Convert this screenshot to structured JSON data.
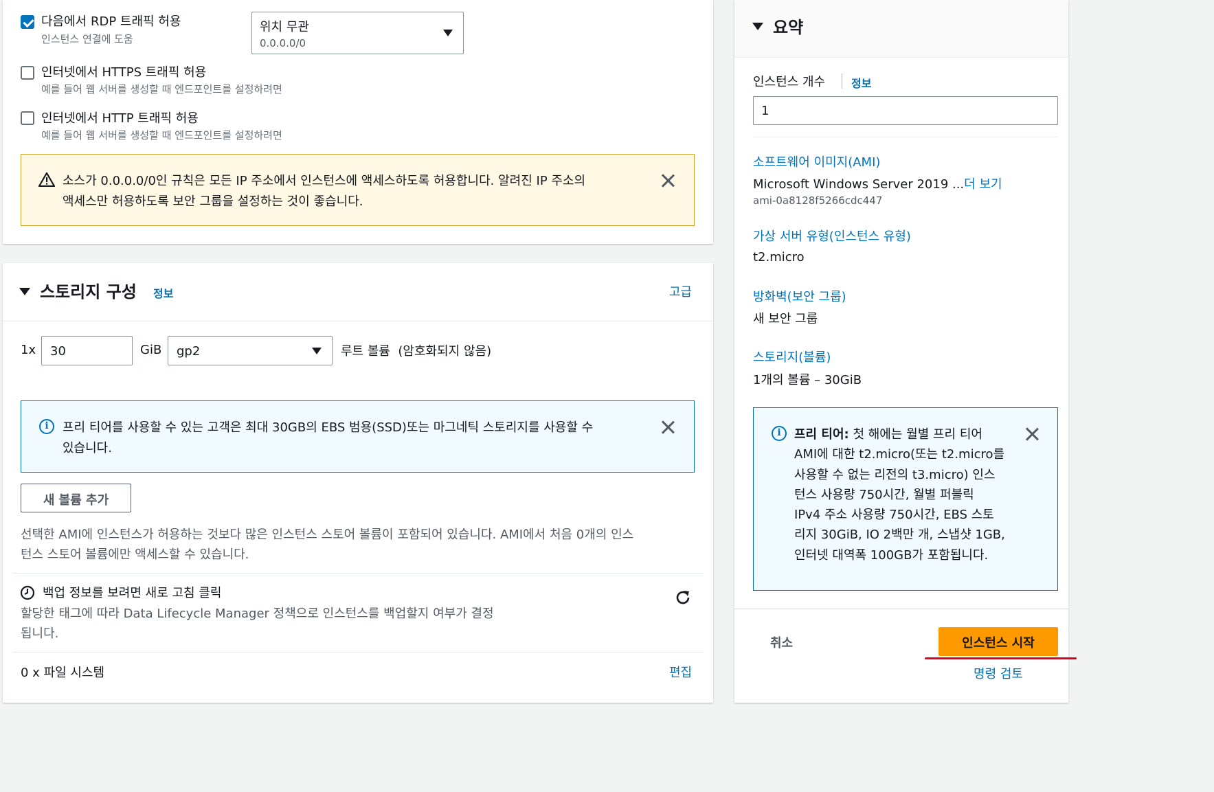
{
  "network": {
    "rdp": {
      "label": "다음에서 RDP 트래픽 허용",
      "desc": "인스턴스 연결에 도움",
      "checked": true
    },
    "source_select": {
      "value": "위치 무관",
      "sub": "0.0.0.0/0"
    },
    "https": {
      "label": "인터넷에서 HTTPS 트래픽 허용",
      "desc": "예를 들어 웹 서버를 생성할 때 엔드포인트를 설정하려면",
      "checked": false
    },
    "http": {
      "label": "인터넷에서 HTTP 트래픽 허용",
      "desc": "예를 들어 웹 서버를 생성할 때 엔드포인트를 설정하려면",
      "checked": false
    },
    "warning": {
      "line1": "소스가 0.0.0.0/0인 규칙은 모든 IP 주소에서 인스턴스에 액세스하도록 허용합니다. 알려진 IP 주소의",
      "line2": "액세스만 허용하도록 보안 그룹을 설정하는 것이 좋습니다."
    }
  },
  "storage": {
    "title": "스토리지 구성",
    "info": "정보",
    "advanced": "고급",
    "multiplier": "1x",
    "size": "30",
    "unit": "GiB",
    "volume_type": "gp2",
    "root_label": "루트 볼륨  (암호화되지 않음)",
    "free_tier_line1": "프리 티어를 사용할 수 있는 고객은 최대 30GB의 EBS 범용(SSD)또는 마그네틱 스토리지를 사용할 수",
    "free_tier_line2": "있습니다.",
    "add_volume": "새 볼륨 추가",
    "ami_note_line1": "선택한 AMI에 인스턴스가 허용하는 것보다 많은 인스턴스 스토어 볼륨이 포함되어 있습니다. AMI에서 처음 0개의 인스",
    "ami_note_line2": "턴스 스토어 볼륨에만 액세스할 수 있습니다.",
    "backup_title": "백업 정보를 보려면 새로 고침 클릭",
    "backup_desc_line1": "할당한 태그에 따라 Data Lifecycle Manager 정책으로 인스턴스를 백업할지 여부가 결정",
    "backup_desc_line2": "됩니다.",
    "fs_label": "0 x 파일 시스템",
    "edit": "편집"
  },
  "summary": {
    "title": "요약",
    "count_label": "인스턴스 개수",
    "count_info": "정보",
    "count_value": "1",
    "ami_label": "소프트웨어 이미지(AMI)",
    "ami_value": "Microsoft Windows Server 2019 ...",
    "ami_more": "더 보기",
    "ami_id": "ami-0a8128f5266cdc447",
    "type_label": "가상 서버 유형(인스턴스 유형)",
    "type_value": "t2.micro",
    "firewall_label": "방화벽(보안 그룹)",
    "firewall_value": "새 보안 그룹",
    "storage_label": "스토리지(볼륨)",
    "storage_value": "1개의 볼륨 – 30GiB",
    "free_tier_bold": "프리 티어:",
    "free_tier_lines": [
      "첫 해에는 월별 프리 티어",
      "AMI에 대한 t2.micro(또는 t2.micro를",
      "사용할 수 없는 리전의 t3.micro) 인스",
      "턴스 사용량 750시간, 월별 퍼블릭",
      "IPv4 주소 사용량 750시간, EBS 스토",
      "리지 30GiB, IO 2백만 개, 스냅샷 1GB,",
      "인터넷 대역폭 100GB가 포함됩니다."
    ],
    "cancel": "취소",
    "launch": "인스턴스 시작",
    "review": "명령 검토"
  },
  "colors": {
    "accent": "#0073bb",
    "launch": "#ff9900",
    "warning_bg": "#fef8e4",
    "warning_border": "#c8a02a",
    "info_bg": "#f1faff",
    "underline": "#e0001b"
  }
}
